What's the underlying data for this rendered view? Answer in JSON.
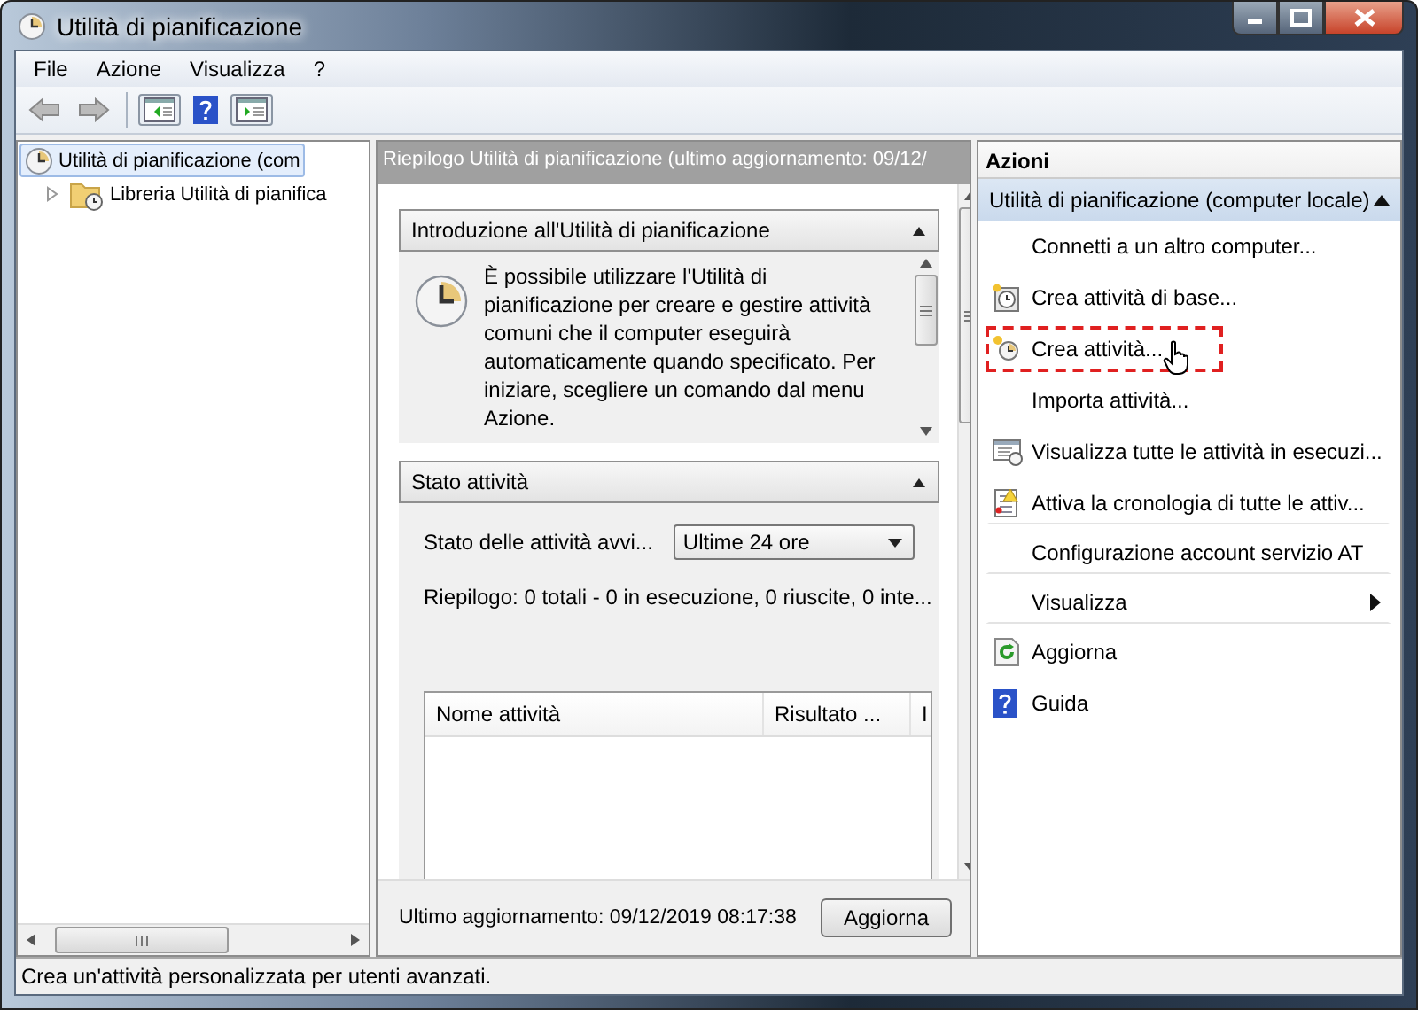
{
  "window": {
    "title": "Utilità di pianificazione"
  },
  "menu": [
    "File",
    "Azione",
    "Visualizza",
    "?"
  ],
  "tree": [
    {
      "label": "Utilità di pianificazione (com",
      "selected": true,
      "children": [
        {
          "label": "Libreria Utilità di pianifica",
          "selected": false,
          "expanded": false
        }
      ]
    }
  ],
  "summary": {
    "header": "Riepilogo Utilità di pianificazione (ultimo aggiornamento: 09/12/",
    "sections": [
      {
        "kind": "intro",
        "title": "Introduzione all'Utilità di pianificazione",
        "expanded": true,
        "text": "È possibile utilizzare l'Utilità di pianificazione per creare e gestire attività comuni che il computer eseguirà automaticamente quando specificato. Per iniziare, scegliere un comando dal menu Azione."
      },
      {
        "kind": "status",
        "title": "Stato attività",
        "expanded": true,
        "filter_label": "Stato delle attività avvi...",
        "filter_value": "Ultime 24 ore",
        "summary": "Riepilogo: 0 totali - 0 in esecuzione, 0 riuscite, 0 inte...",
        "columns": [
          "Nome attività",
          "Risultato ...",
          "I"
        ]
      }
    ],
    "last_update": "Ultimo aggiornamento: 09/12/2019 08:17:38",
    "refresh_button": "Aggiorna"
  },
  "actions": {
    "title": "Azioni",
    "group": "Utilità di pianificazione (computer locale)",
    "group_expanded": true,
    "items": [
      {
        "label": "Connetti a un altro computer...",
        "kind": "plain",
        "highlighted": false,
        "separator_after": false
      },
      {
        "label": "Crea attività di base...",
        "kind": "clock-star",
        "highlighted": false,
        "separator_after": false
      },
      {
        "label": "Crea attività...",
        "kind": "clock-new",
        "highlighted": true,
        "separator_after": false
      },
      {
        "label": "Importa attività...",
        "kind": "plain",
        "highlighted": false,
        "separator_after": false
      },
      {
        "label": "Visualizza tutte le attività in esecuzi...",
        "kind": "list",
        "highlighted": false,
        "separator_after": false
      },
      {
        "label": "Attiva la cronologia di tutte le attiv...",
        "kind": "log",
        "highlighted": false,
        "separator_after": true
      },
      {
        "label": "Configurazione account servizio AT",
        "kind": "plain",
        "highlighted": false,
        "separator_after": true
      },
      {
        "label": "Visualizza",
        "kind": "submenu",
        "highlighted": false,
        "separator_after": true
      },
      {
        "label": "Aggiorna",
        "kind": "refresh",
        "highlighted": false,
        "separator_after": false
      },
      {
        "label": "Guida",
        "kind": "help",
        "highlighted": false,
        "separator_after": false
      }
    ]
  },
  "status_bar": "Crea un'attività personalizzata per utenti avanzati."
}
